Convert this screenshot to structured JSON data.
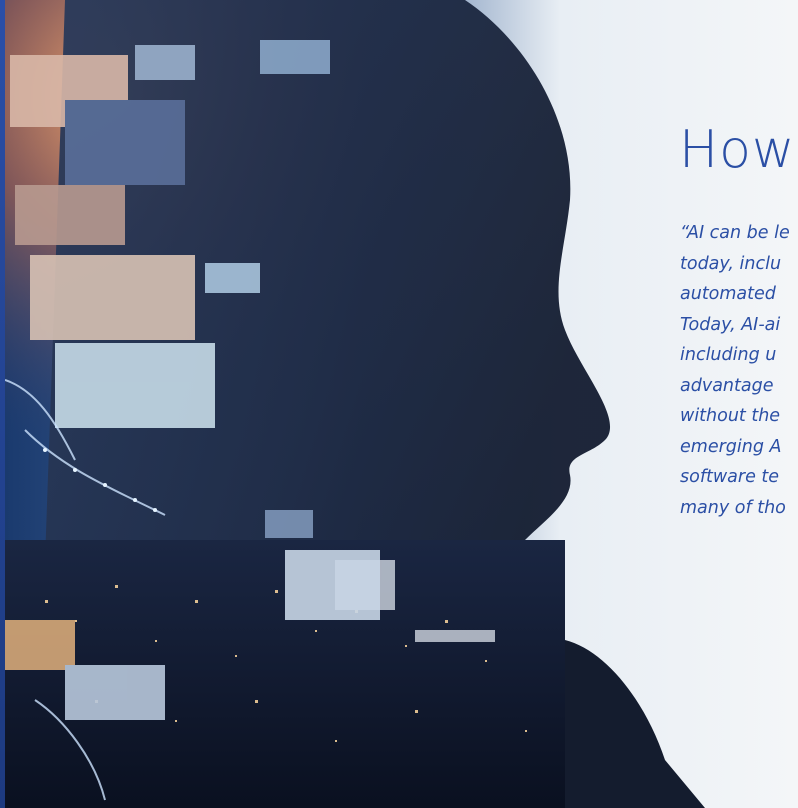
{
  "heading": "How",
  "quote_lines": [
    "“AI can be le",
    "today, inclu",
    "automated",
    "Today, AI-ai",
    "including u",
    "advantage",
    "without the",
    "emerging A",
    "software te",
    "many of tho"
  ],
  "colors": {
    "accent_blue": "#2b4fa5",
    "left_bar": "#2a4fa8",
    "background": "#f4f6f8"
  }
}
